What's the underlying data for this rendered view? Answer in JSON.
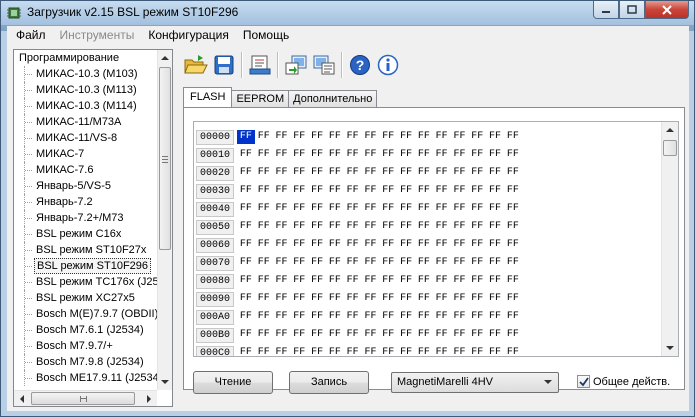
{
  "window": {
    "title": "Загрузчик v2.15 BSL режим ST10F296"
  },
  "menu": [
    {
      "label": "Файл",
      "enabled": true
    },
    {
      "label": "Инструменты",
      "enabled": false
    },
    {
      "label": "Конфигурация",
      "enabled": true
    },
    {
      "label": "Помощь",
      "enabled": true
    }
  ],
  "toolbar": {
    "icons": [
      "open-folder-icon",
      "save-disk-icon",
      "settings-sheet-icon",
      "read-ecu-icon",
      "write-ecu-icon",
      "help-icon",
      "info-icon"
    ]
  },
  "tree": {
    "root": "Программирование",
    "items": [
      "МИКАС-10.3 (M103)",
      "МИКАС-10.3 (M113)",
      "МИКАС-10.3 (M114)",
      "МИКАС-11/M73A",
      "МИКАС-11/VS-8",
      "МИКАС-7",
      "МИКАС-7.6",
      "Январь-5/VS-5",
      "Январь-7.2",
      "Январь-7.2+/M73",
      "BSL режим C16x",
      "BSL режим ST10F27x",
      "BSL режим ST10F296",
      "BSL режим TC176x (J25",
      "BSL режим XC27x5",
      "Bosch M(E)7.9.7 (OBDII)",
      "Bosch M7.6.1 (J2534)",
      "Bosch M7.9.7/+",
      "Bosch M7.9.8 (J2534)",
      "Bosch ME17.9.11 (J2534"
    ],
    "selected": "BSL режим ST10F296"
  },
  "tabs": [
    {
      "label": "FLASH",
      "active": true
    },
    {
      "label": "EEPROM",
      "active": false
    },
    {
      "label": "Дополнительно",
      "active": false
    }
  ],
  "hex": {
    "addresses": [
      "00000",
      "00010",
      "00020",
      "00030",
      "00040",
      "00050",
      "00060",
      "00070",
      "00080",
      "00090",
      "000A0",
      "000B0",
      "000C0"
    ],
    "byte_value": "FF",
    "bytes_per_row": 16,
    "selected_cell": {
      "row": 0,
      "col": 0
    }
  },
  "buttons": {
    "read": "Чтение",
    "write": "Запись"
  },
  "combo": {
    "value": "MagnetiMarelli 4HV"
  },
  "checkbox": {
    "label": "Общее действ.",
    "checked": true
  },
  "colors": {
    "selection": "#0033cc",
    "titlebar": "#a3c0de"
  }
}
